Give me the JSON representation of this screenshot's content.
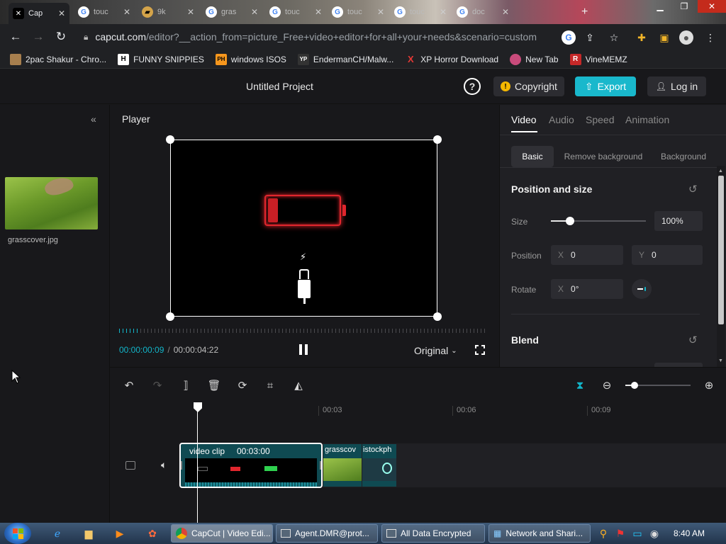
{
  "browser": {
    "tabs": [
      {
        "title": "Cap",
        "icon": "capcut-icon",
        "active": true
      },
      {
        "title": "touc",
        "icon": "google-icon"
      },
      {
        "title": "9k",
        "icon": "folder-icon"
      },
      {
        "title": "gras",
        "icon": "google-icon"
      },
      {
        "title": "touc",
        "icon": "google-icon"
      },
      {
        "title": "touc",
        "icon": "google-icon"
      },
      {
        "title": "touc",
        "icon": "google-icon"
      },
      {
        "title": "doc",
        "icon": "google-icon"
      }
    ],
    "new_tab": "+",
    "url_host": "capcut.com",
    "url_path": "/editor?__action_from=picture_Free+video+editor+for+all+your+needs&scenario=custom",
    "bookmarks": [
      {
        "label": "2pac Shakur - Chro...",
        "icon": "image-icon"
      },
      {
        "label": "FUNNY SNIPPIES",
        "icon": "h-icon",
        "glyph": "H"
      },
      {
        "label": "windows ISOS",
        "icon": "ph-icon",
        "glyph": "PH"
      },
      {
        "label": "EndermanCH/Malw...",
        "icon": "yp-icon",
        "glyph": "YP"
      },
      {
        "label": "XP Horror Download",
        "icon": "x-icon",
        "glyph": "X"
      },
      {
        "label": "New Tab",
        "icon": "circle-icon"
      },
      {
        "label": "VineMEMZ",
        "icon": "r-icon",
        "glyph": "R"
      }
    ]
  },
  "app": {
    "project_title": "Untitled Project",
    "help": "?",
    "copyright": "Copyright",
    "export": "Export",
    "login": "Log in",
    "media": {
      "filename": "grasscover.jpg"
    },
    "player": {
      "title": "Player",
      "current_time": "00:00:00:09",
      "separator": "/",
      "total_time": "00:00:04:22",
      "ratio": "Original"
    },
    "panel": {
      "tabs": [
        "Video",
        "Audio",
        "Speed",
        "Animation"
      ],
      "subtabs": [
        "Basic",
        "Remove background",
        "Background"
      ],
      "position_size": "Position and size",
      "size_label": "Size",
      "size_value": "100%",
      "size_fraction": 0.2,
      "position_label": "Position",
      "pos_x_axis": "X",
      "pos_x": "0",
      "pos_y_axis": "Y",
      "pos_y": "0",
      "rotate_label": "Rotate",
      "rot_axis": "X",
      "rotate_value": "0°",
      "blend": "Blend"
    },
    "timeline": {
      "ticks": [
        "00:03",
        "00:06",
        "00:09"
      ],
      "clip_label": "video clip",
      "clip_duration": "00:03:00",
      "clip2_label": "grasscov",
      "clip3_label": "istockph"
    }
  },
  "taskbar": {
    "buttons": [
      {
        "label": "CapCut | Video Edi...",
        "active": true
      },
      {
        "label": "Agent.DMR@prot..."
      },
      {
        "label": "All Data Encrypted"
      },
      {
        "label": "Network and Shari..."
      }
    ],
    "clock": "8:40 AM"
  },
  "colors": {
    "accent": "#12b5c9",
    "export_bg": "#19b8cc",
    "battery_red": "#e0262d",
    "battery_green": "#2fd14f"
  }
}
